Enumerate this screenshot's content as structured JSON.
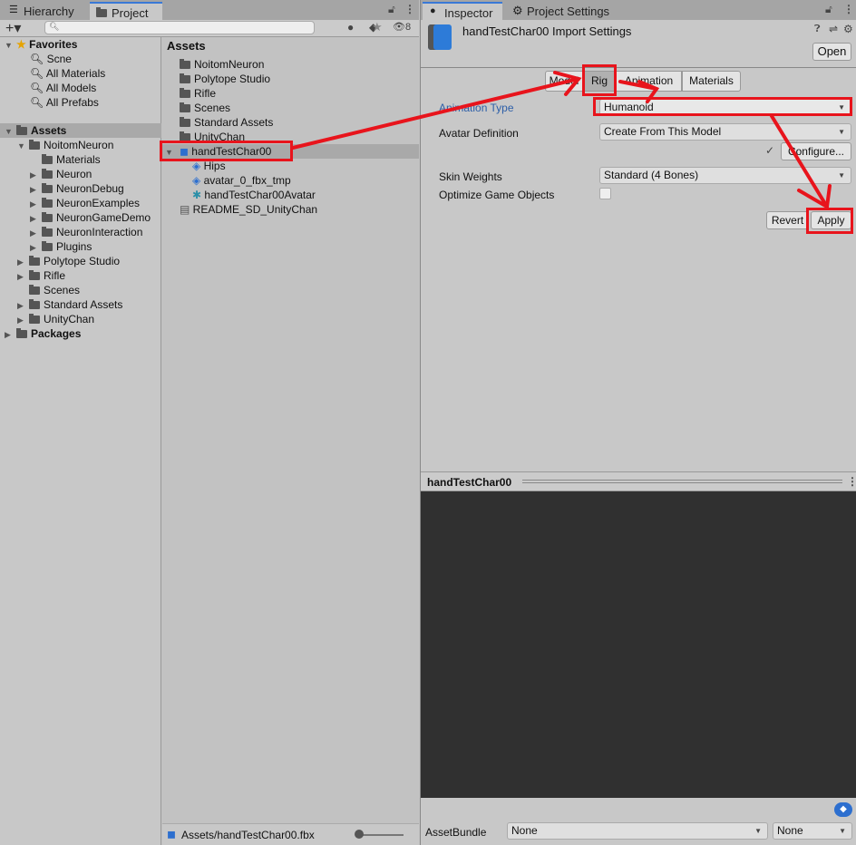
{
  "project_window": {
    "tabs": [
      {
        "label": "Hierarchy",
        "icon": "list-icon"
      },
      {
        "label": "Project",
        "icon": "folder-icon"
      }
    ],
    "search_placeholder": "",
    "hidden_count": "8",
    "favorites": {
      "label": "Favorites",
      "items": [
        "Scne",
        "All Materials",
        "All Models",
        "All Prefabs"
      ]
    },
    "tree": [
      {
        "label": "Assets",
        "depth": 0,
        "bold": true
      },
      {
        "label": "NoitomNeuron",
        "depth": 1
      },
      {
        "label": "Materials",
        "depth": 2
      },
      {
        "label": "Neuron",
        "depth": 2
      },
      {
        "label": "NeuronDebug",
        "depth": 2
      },
      {
        "label": "NeuronExamples",
        "depth": 2
      },
      {
        "label": "NeuronGameDemo",
        "depth": 2
      },
      {
        "label": "NeuronInteraction",
        "depth": 2
      },
      {
        "label": "Plugins",
        "depth": 2
      },
      {
        "label": "Polytope Studio",
        "depth": 1
      },
      {
        "label": "Rifle",
        "depth": 1
      },
      {
        "label": "Scenes",
        "depth": 1
      },
      {
        "label": "Standard Assets",
        "depth": 1
      },
      {
        "label": "UnityChan",
        "depth": 1
      },
      {
        "label": "Packages",
        "depth": 0,
        "bold": true
      }
    ],
    "assets_header": "Assets",
    "assets": [
      {
        "label": "NoitomNeuron",
        "icon": "folder-icon"
      },
      {
        "label": "Polytope Studio",
        "icon": "folder-icon"
      },
      {
        "label": "Rifle",
        "icon": "folder-icon"
      },
      {
        "label": "Scenes",
        "icon": "folder-icon"
      },
      {
        "label": "Standard Assets",
        "icon": "folder-icon"
      },
      {
        "label": "UnityChan",
        "icon": "folder-icon"
      },
      {
        "label": "handTestChar00",
        "icon": "model-icon",
        "selected": true
      },
      {
        "label": "Hips",
        "icon": "mesh-icon"
      },
      {
        "label": "avatar_0_fbx_tmp",
        "icon": "mesh-icon"
      },
      {
        "label": "handTestChar00Avatar",
        "icon": "avatar-icon"
      },
      {
        "label": "README_SD_UnityChan",
        "icon": "document-icon"
      }
    ],
    "footer_path": "Assets/handTestChar00.fbx"
  },
  "inspector": {
    "tabs": [
      {
        "label": "Inspector"
      },
      {
        "label": "Project Settings"
      }
    ],
    "title": "handTestChar00 Import Settings",
    "open_label": "Open",
    "sub_tabs": [
      "Model",
      "Rig",
      "Animation",
      "Materials"
    ],
    "active_sub_tab": "Rig",
    "fields": {
      "animation_type_label": "Animation Type",
      "animation_type_value": "Humanoid",
      "avatar_definition_label": "Avatar Definition",
      "avatar_definition_value": "Create From This Model",
      "configure_label": "Configure...",
      "skin_weights_label": "Skin Weights",
      "skin_weights_value": "Standard (4 Bones)",
      "optimize_label": "Optimize Game Objects",
      "optimize_checked": false
    },
    "revert_label": "Revert",
    "apply_label": "Apply",
    "preview_title": "handTestChar00",
    "asset_bundle_label": "AssetBundle",
    "asset_bundle_value": "None",
    "asset_bundle_variant": "None"
  },
  "colors": {
    "annotation": "#e8141c",
    "accent": "#3a79d6",
    "selected_row": "#a9a9a9"
  }
}
